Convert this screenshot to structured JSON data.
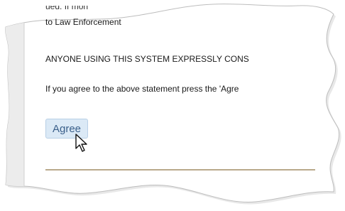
{
  "notice": {
    "partial_top": "ued. If mon",
    "law_line": "to Law Enforcement",
    "consent_line": "ANYONE USING THIS SYSTEM EXPRESSLY CONS",
    "agree_instruction": "If you agree to the above statement press the 'Agre"
  },
  "actions": {
    "agree_label": "Agree"
  },
  "icons": {
    "cursor": "mouse-pointer-icon"
  },
  "colors": {
    "button_bg": "#dbe9f6",
    "button_text": "#3a5f8a",
    "divider": "#b9a98b",
    "sidebar_strip": "#ececec"
  }
}
